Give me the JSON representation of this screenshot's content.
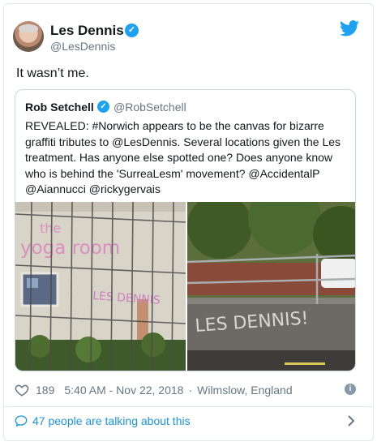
{
  "author": {
    "name": "Les Dennis",
    "handle": "@LesDennis",
    "verified_mark": "✓",
    "avatar_icon": "avatar-les-dennis",
    "platform_icon": "twitter-bird-icon"
  },
  "tweet": {
    "text": "It wasn’t me."
  },
  "quoted_tweet": {
    "name": "Rob Setchell",
    "handle": "@RobSetchell",
    "verified_mark": "✓",
    "text": "REVEALED: #Norwich appears to be the canvas for bizarre graffiti tributes to @LesDennis. Several locations given the Les treatment. Has anyone else spotted one? Does anyone know who is behind the 'SurreaLesm' movement? @AccidentalP @Aiannucci @rickygervais",
    "photos": [
      {
        "sign_text": "the",
        "sign_text2": "yoga room",
        "graffiti": "LES DENNIS"
      },
      {
        "graffiti": "LES DENNIS!"
      }
    ]
  },
  "meta": {
    "likes": "189",
    "time": "5:40 AM - Nov 22, 2018",
    "separator": "·",
    "location": "Wilmslow, England",
    "info_mark": "i"
  },
  "footer": {
    "talking": "47 people are talking about this"
  },
  "colors": {
    "accent": "#1da1f2",
    "link": "#1b95e0",
    "muted": "#657786",
    "border": "#e1e8ed"
  }
}
